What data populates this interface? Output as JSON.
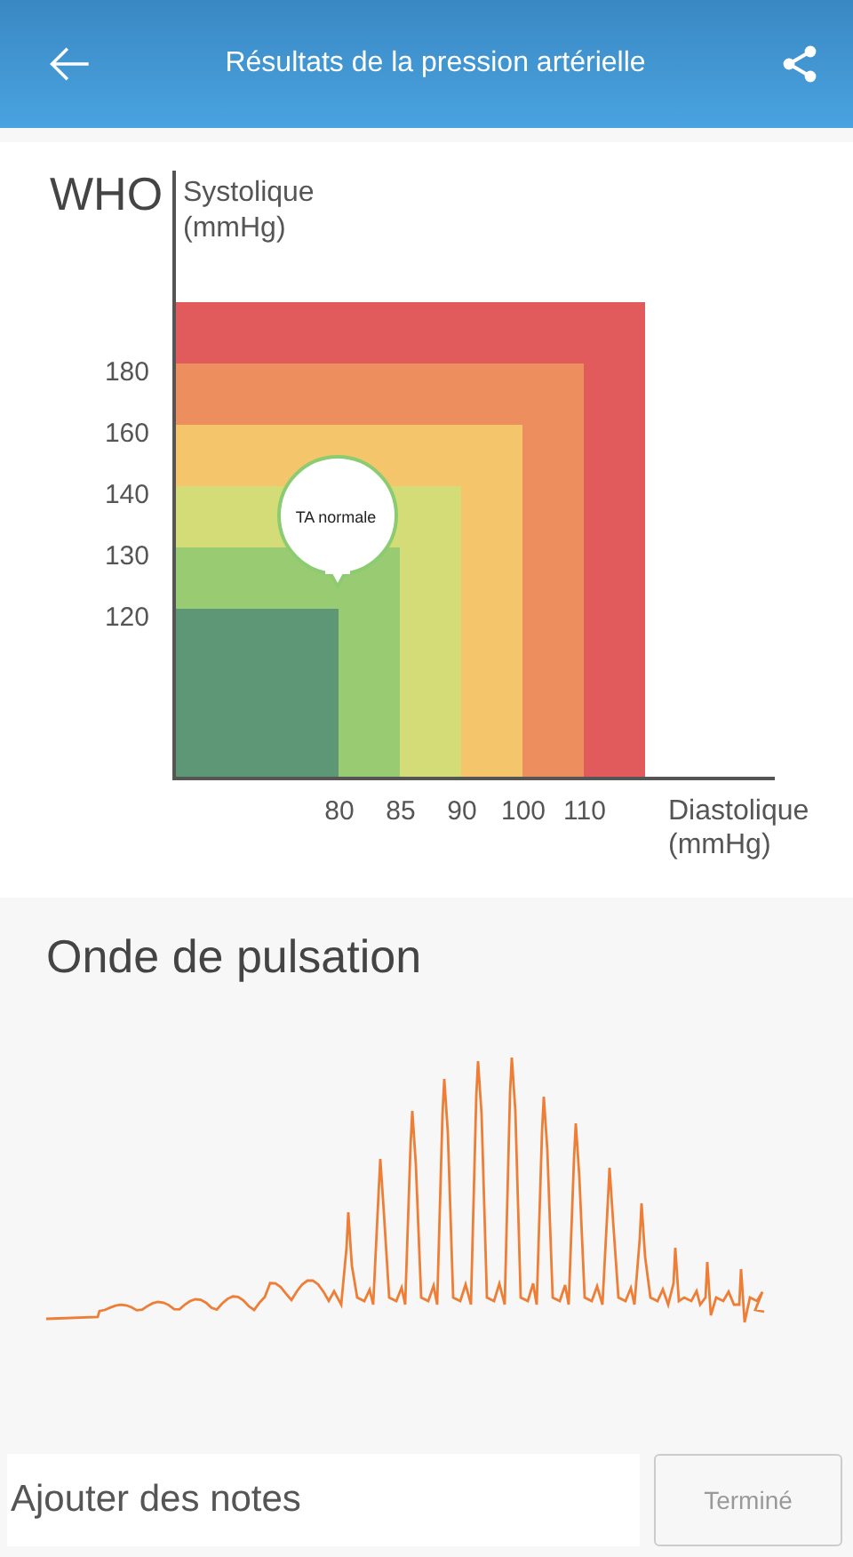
{
  "header": {
    "title": "Résultats de la pression artérielle"
  },
  "who_chart": {
    "title": "WHO",
    "y_axis_label": [
      "Systolique",
      "(mmHg)"
    ],
    "x_axis_label": [
      "Diastolique",
      "(mmHg)"
    ],
    "y_ticks": [
      "180",
      "160",
      "140",
      "130",
      "120"
    ],
    "x_ticks": [
      "80",
      "85",
      "90",
      "100",
      "110"
    ],
    "zones": [
      {
        "color": "#e15a5c"
      },
      {
        "color": "#ec8e5e"
      },
      {
        "color": "#f5c56b"
      },
      {
        "color": "#d4dc78"
      },
      {
        "color": "#99cb72"
      },
      {
        "color": "#5e9775"
      }
    ],
    "marker": {
      "label": "TA normale"
    }
  },
  "pulse_wave": {
    "title": "Onde de pulsation"
  },
  "notes": {
    "placeholder": "Ajouter des notes"
  },
  "done_button": {
    "label": "Terminé",
    "disabled": true
  }
}
